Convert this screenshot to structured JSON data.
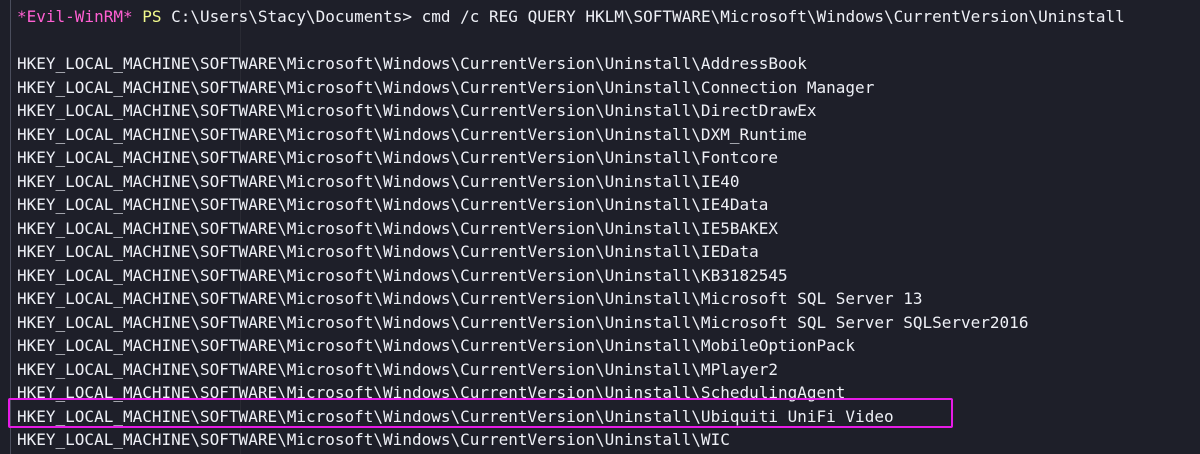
{
  "terminal": {
    "prompt": {
      "shell_tag": "*Evil-WinRM*",
      "ps_label": "PS",
      "path": "C:\\Users\\Stacy\\Documents>",
      "command": "cmd /c REG QUERY HKLM\\SOFTWARE\\Microsoft\\Windows\\CurrentVersion\\Uninstall"
    },
    "output_lines": [
      "HKEY_LOCAL_MACHINE\\SOFTWARE\\Microsoft\\Windows\\CurrentVersion\\Uninstall\\AddressBook",
      "HKEY_LOCAL_MACHINE\\SOFTWARE\\Microsoft\\Windows\\CurrentVersion\\Uninstall\\Connection Manager",
      "HKEY_LOCAL_MACHINE\\SOFTWARE\\Microsoft\\Windows\\CurrentVersion\\Uninstall\\DirectDrawEx",
      "HKEY_LOCAL_MACHINE\\SOFTWARE\\Microsoft\\Windows\\CurrentVersion\\Uninstall\\DXM_Runtime",
      "HKEY_LOCAL_MACHINE\\SOFTWARE\\Microsoft\\Windows\\CurrentVersion\\Uninstall\\Fontcore",
      "HKEY_LOCAL_MACHINE\\SOFTWARE\\Microsoft\\Windows\\CurrentVersion\\Uninstall\\IE40",
      "HKEY_LOCAL_MACHINE\\SOFTWARE\\Microsoft\\Windows\\CurrentVersion\\Uninstall\\IE4Data",
      "HKEY_LOCAL_MACHINE\\SOFTWARE\\Microsoft\\Windows\\CurrentVersion\\Uninstall\\IE5BAKEX",
      "HKEY_LOCAL_MACHINE\\SOFTWARE\\Microsoft\\Windows\\CurrentVersion\\Uninstall\\IEData",
      "HKEY_LOCAL_MACHINE\\SOFTWARE\\Microsoft\\Windows\\CurrentVersion\\Uninstall\\KB3182545",
      "HKEY_LOCAL_MACHINE\\SOFTWARE\\Microsoft\\Windows\\CurrentVersion\\Uninstall\\Microsoft SQL Server 13",
      "HKEY_LOCAL_MACHINE\\SOFTWARE\\Microsoft\\Windows\\CurrentVersion\\Uninstall\\Microsoft SQL Server SQLServer2016",
      "HKEY_LOCAL_MACHINE\\SOFTWARE\\Microsoft\\Windows\\CurrentVersion\\Uninstall\\MobileOptionPack",
      "HKEY_LOCAL_MACHINE\\SOFTWARE\\Microsoft\\Windows\\CurrentVersion\\Uninstall\\MPlayer2",
      "HKEY_LOCAL_MACHINE\\SOFTWARE\\Microsoft\\Windows\\CurrentVersion\\Uninstall\\SchedulingAgent",
      "HKEY_LOCAL_MACHINE\\SOFTWARE\\Microsoft\\Windows\\CurrentVersion\\Uninstall\\Ubiquiti UniFi Video",
      "HKEY_LOCAL_MACHINE\\SOFTWARE\\Microsoft\\Windows\\CurrentVersion\\Uninstall\\WIC"
    ],
    "colors": {
      "background": "#1e1f29",
      "text": "#eef0f6",
      "shell_tag": "#ff5fd2",
      "ps_label": "#f1fa8c",
      "highlight_border": "#e61be6"
    }
  }
}
